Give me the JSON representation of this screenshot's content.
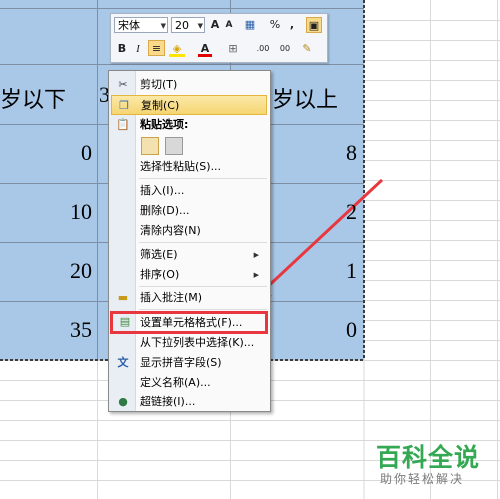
{
  "sheet": {
    "header_left": "岁以下",
    "header_mid": "3",
    "header_right": "岁以上",
    "col_left_values": [
      "0",
      "10",
      "20",
      "35"
    ],
    "col_right_values": [
      "8",
      "2",
      "1",
      "0"
    ]
  },
  "mini_toolbar": {
    "font_name": "宋体",
    "font_size": "20",
    "grow_font": "A",
    "shrink_font": "A",
    "currency": "▦",
    "percent": "%",
    "comma": ",",
    "merge": "▣",
    "bold": "B",
    "italic": "I",
    "align_center": "≡",
    "fill_color": "◈",
    "font_color": "A",
    "borders": "⊞",
    "inc_decimal": ".00",
    "dec_decimal": "00",
    "format_painter": "✎"
  },
  "context_menu": {
    "items": [
      {
        "label": "剪切(T)",
        "icon": "scissors-icon"
      },
      {
        "label": "复制(C)",
        "icon": "copy-icon"
      },
      {
        "label": "粘贴选项:",
        "icon": "paste-icon"
      },
      {
        "label": "选择性粘贴(S)..."
      },
      {
        "label": "插入(I)..."
      },
      {
        "label": "删除(D)..."
      },
      {
        "label": "清除内容(N)"
      },
      {
        "label": "筛选(E)"
      },
      {
        "label": "排序(O)"
      },
      {
        "label": "插入批注(M)",
        "icon": "comment-icon"
      },
      {
        "label": "设置单元格格式(F)...",
        "icon": "format-cells-icon"
      },
      {
        "label": "从下拉列表中选择(K)..."
      },
      {
        "label": "显示拼音字段(S)",
        "icon": "phonetic-icon"
      },
      {
        "label": "定义名称(A)..."
      },
      {
        "label": "超链接(I)...",
        "icon": "hyperlink-icon"
      }
    ]
  },
  "watermark": {
    "title": "百科全说",
    "subtitle": "助你轻松解决"
  },
  "colors": {
    "selection": "#a9c8e8",
    "gridline": "#d4d4d4",
    "annotation_red": "#e8373e",
    "watermark_green": "#34a853"
  }
}
